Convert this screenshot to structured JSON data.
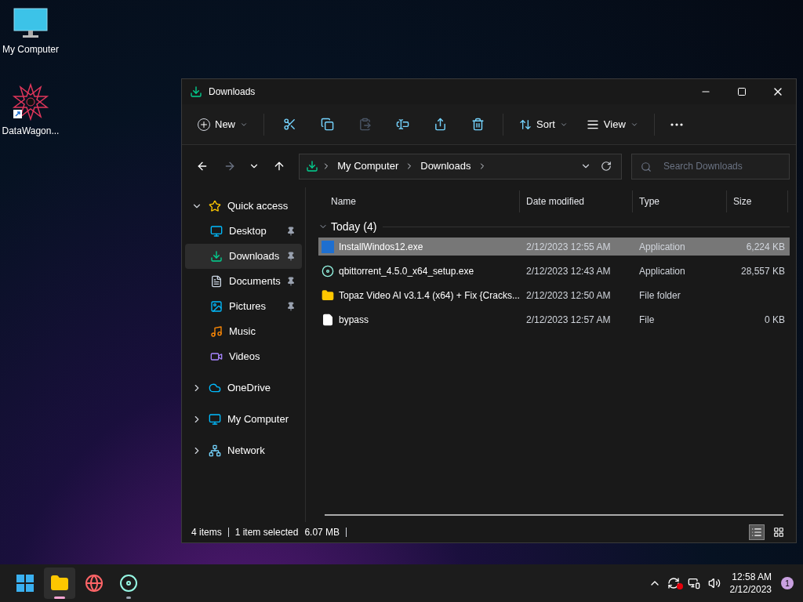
{
  "desktop_icons": [
    {
      "label": "My Computer",
      "kind": "computer"
    },
    {
      "label": "DataWagon...",
      "kind": "shortcut"
    }
  ],
  "window": {
    "title": "Downloads"
  },
  "toolbar": {
    "new": "New",
    "actions": [
      {
        "kind": "cut",
        "disabled": false
      },
      {
        "kind": "copy",
        "disabled": false
      },
      {
        "kind": "paste",
        "disabled": true
      },
      {
        "kind": "rename",
        "disabled": false
      },
      {
        "kind": "share",
        "disabled": false
      },
      {
        "kind": "delete",
        "disabled": false
      }
    ],
    "sort": "Sort",
    "view": "View"
  },
  "address": {
    "crumbs": [
      "My Computer",
      "Downloads"
    ],
    "search_placeholder": "Search Downloads"
  },
  "sidebar": [
    {
      "label": "Quick access",
      "kind": "star",
      "expanded": true,
      "selected": false,
      "children": [
        {
          "label": "Desktop",
          "kind": "desktop",
          "pinned": true,
          "selected": false
        },
        {
          "label": "Downloads",
          "kind": "downloads",
          "pinned": true,
          "selected": true
        },
        {
          "label": "Documents",
          "kind": "documents",
          "pinned": true,
          "selected": false
        },
        {
          "label": "Pictures",
          "kind": "pictures",
          "pinned": true,
          "selected": false
        },
        {
          "label": "Music",
          "kind": "music",
          "pinned": false,
          "selected": false
        },
        {
          "label": "Videos",
          "kind": "videos",
          "pinned": false,
          "selected": false
        }
      ]
    },
    {
      "label": "OneDrive",
      "kind": "cloud",
      "expanded": false,
      "selected": false
    },
    {
      "label": "My Computer",
      "kind": "computer",
      "expanded": false,
      "selected": false
    },
    {
      "label": "Network",
      "kind": "network",
      "expanded": false,
      "selected": false
    }
  ],
  "columns": [
    "Name",
    "Date modified",
    "Type",
    "Size"
  ],
  "group": {
    "label": "Today (4)",
    "expanded": true
  },
  "rows": [
    {
      "name": "InstallWindos12.exe",
      "date": "2/12/2023 12:55 AM",
      "type": "Application",
      "size": "6,224 KB",
      "kind": "app",
      "selected": true
    },
    {
      "name": "qbittorrent_4.5.0_x64_setup.exe",
      "date": "2/12/2023 12:43 AM",
      "type": "Application",
      "size": "28,557 KB",
      "kind": "installer",
      "selected": false
    },
    {
      "name": "Topaz Video AI v3.1.4 (x64) + Fix {Cracks...",
      "date": "2/12/2023 12:50 AM",
      "type": "File folder",
      "kind": "folder",
      "selected": false
    },
    {
      "name": "bypass",
      "date": "2/12/2023 12:57 AM",
      "type": "File",
      "size": "0 KB",
      "kind": "file",
      "selected": false
    }
  ],
  "status_bar": {
    "items": "4 items",
    "selection": "1 item selected",
    "selection_size": "6.07 MB",
    "views": [
      {
        "kind": "details",
        "selected": true
      },
      {
        "kind": "tiles",
        "selected": false
      }
    ]
  },
  "taskbar": {
    "apps": [
      {
        "kind": "start",
        "active": false,
        "running": false
      },
      {
        "kind": "explorer",
        "active": true,
        "running": true
      },
      {
        "kind": "browser",
        "active": false,
        "running": false
      },
      {
        "kind": "installer",
        "active": false,
        "running": true
      }
    ],
    "time": "12:58 AM",
    "date": "2/12/2023",
    "notification_count": "1"
  }
}
